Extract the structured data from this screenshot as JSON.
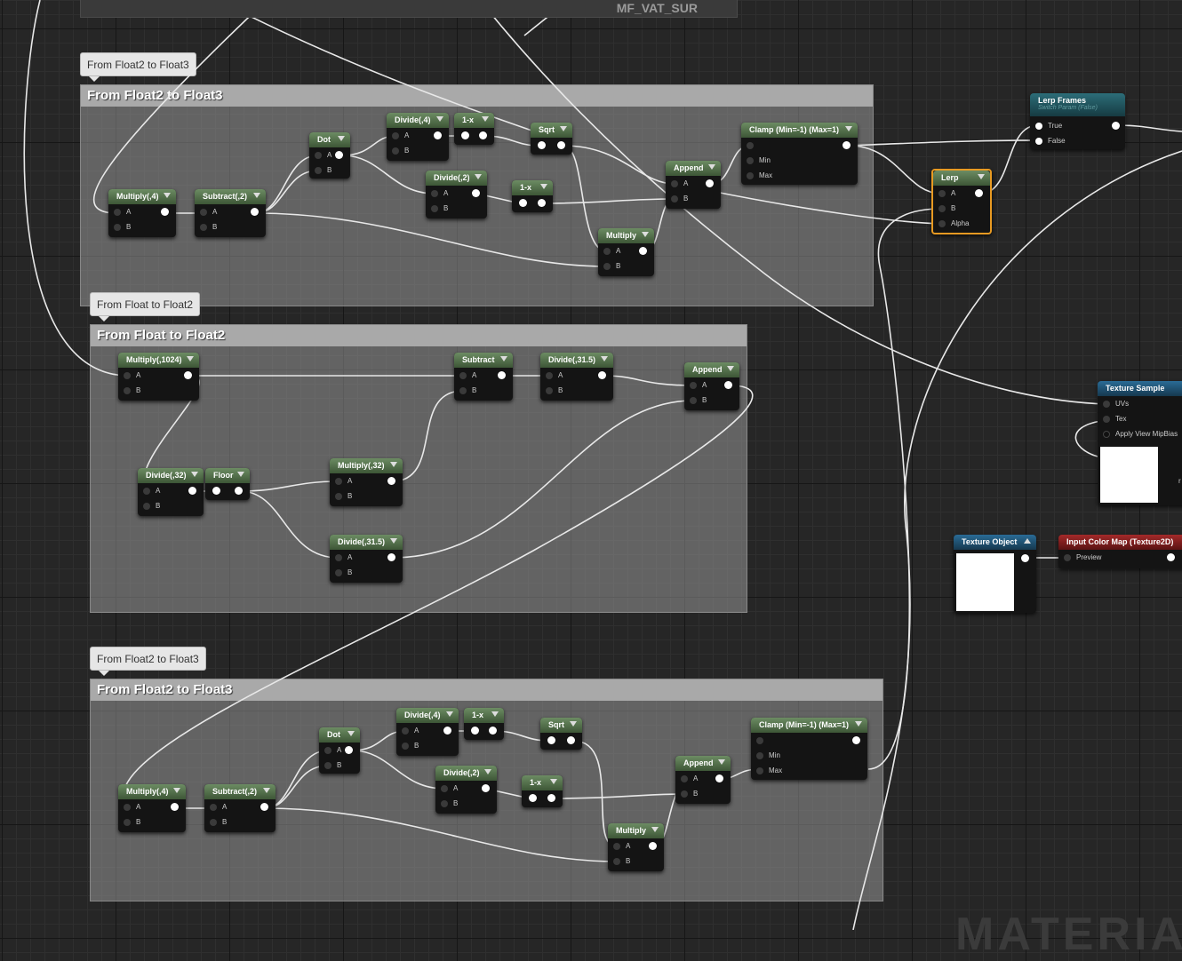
{
  "top_comment": {
    "label": "MF_VAT_SUR"
  },
  "watermark": "MATERIAL",
  "groups": [
    {
      "bubble": "From Float2 to Float3",
      "title": "From Float2 to Float3",
      "nodes": [
        {
          "title": "Multiply(,4)",
          "pins": [
            "A",
            "B"
          ]
        },
        {
          "title": "Subtract(,2)",
          "pins": [
            "A",
            "B"
          ]
        },
        {
          "title": "Dot",
          "pins": [
            "A",
            "B"
          ]
        },
        {
          "title": "Divide(,4)",
          "pins": [
            "A",
            "B"
          ]
        },
        {
          "title": "1-x",
          "pins": []
        },
        {
          "title": "Sqrt",
          "pins": []
        },
        {
          "title": "Divide(,2)",
          "pins": [
            "A",
            "B"
          ]
        },
        {
          "title": "1-x",
          "pins": []
        },
        {
          "title": "Append",
          "pins": [
            "A",
            "B"
          ]
        },
        {
          "title": "Clamp (Min=-1) (Max=1)",
          "pins": [
            "",
            "Min",
            "Max"
          ]
        },
        {
          "title": "Multiply",
          "pins": [
            "A",
            "B"
          ]
        }
      ]
    },
    {
      "bubble": "From Float to Float2",
      "title": "From Float to Float2",
      "nodes": [
        {
          "title": "Multiply(,1024)",
          "pins": [
            "A",
            "B"
          ]
        },
        {
          "title": "Subtract",
          "pins": [
            "A",
            "B"
          ]
        },
        {
          "title": "Divide(,31.5)",
          "pins": [
            "A",
            "B"
          ]
        },
        {
          "title": "Append",
          "pins": [
            "A",
            "B"
          ]
        },
        {
          "title": "Divide(,32)",
          "pins": [
            "A",
            "B"
          ]
        },
        {
          "title": "Floor",
          "pins": []
        },
        {
          "title": "Multiply(,32)",
          "pins": [
            "A",
            "B"
          ]
        },
        {
          "title": "Divide(,31.5)",
          "pins": [
            "A",
            "B"
          ]
        }
      ]
    },
    {
      "bubble": "From Float2 to Float3",
      "title": "From Float2 to Float3",
      "nodes": [
        {
          "title": "Multiply(,4)",
          "pins": [
            "A",
            "B"
          ]
        },
        {
          "title": "Subtract(,2)",
          "pins": [
            "A",
            "B"
          ]
        },
        {
          "title": "Dot",
          "pins": [
            "A",
            "B"
          ]
        },
        {
          "title": "Divide(,4)",
          "pins": [
            "A",
            "B"
          ]
        },
        {
          "title": "1-x",
          "pins": []
        },
        {
          "title": "Sqrt",
          "pins": []
        },
        {
          "title": "Divide(,2)",
          "pins": [
            "A",
            "B"
          ]
        },
        {
          "title": "1-x",
          "pins": []
        },
        {
          "title": "Append",
          "pins": [
            "A",
            "B"
          ]
        },
        {
          "title": "Clamp (Min=-1) (Max=1)",
          "pins": [
            "",
            "Min",
            "Max"
          ]
        },
        {
          "title": "Multiply",
          "pins": [
            "A",
            "B"
          ]
        }
      ]
    }
  ],
  "lerp_frames": {
    "title": "Lerp Frames",
    "subtitle": "Switch Param (False)",
    "pins": [
      "True",
      "False"
    ]
  },
  "lerp": {
    "title": "Lerp",
    "pins": [
      "A",
      "B",
      "Alpha"
    ]
  },
  "texture_sample": {
    "title": "Texture Sample",
    "pins": [
      "UVs",
      "Tex",
      "Apply View MipBias"
    ],
    "cut_label": "r"
  },
  "texture_object": {
    "title": "Texture Object"
  },
  "input_color_map": {
    "title": "Input Color Map (Texture2D)",
    "pins": [
      "Preview"
    ]
  }
}
